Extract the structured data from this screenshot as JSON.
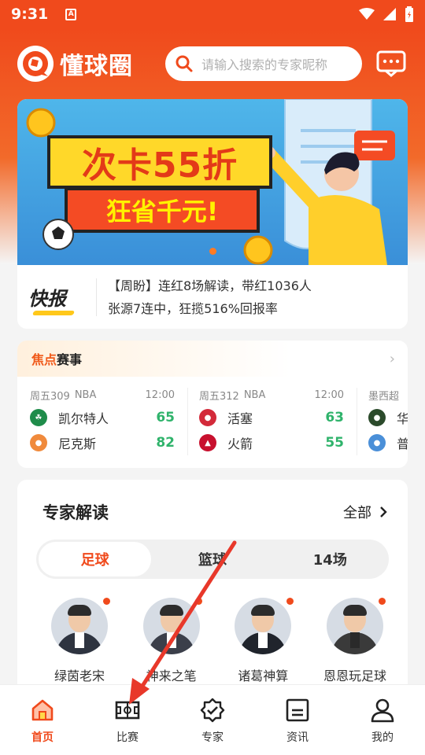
{
  "status": {
    "time": "9:31",
    "a_badge": "A"
  },
  "header": {
    "app_name": "懂球圈",
    "search_placeholder": "请输入搜索的专家昵称"
  },
  "banner": {
    "title": "次卡55折",
    "subtitle": "狂省千元!"
  },
  "news": {
    "badge": "快报",
    "line1": "【周盼】连红8场解读，带红1036人",
    "line2": "张源7连中，狂揽516%回报率"
  },
  "focus": {
    "title_hl": "焦点",
    "title_rest": "赛事",
    "matches": [
      {
        "code": "周五309",
        "league": "NBA",
        "time": "12:00",
        "home": "凯尔特人",
        "home_score": "65",
        "away": "尼克斯",
        "away_score": "82"
      },
      {
        "code": "周五312",
        "league": "NBA",
        "time": "12:00",
        "home": "活塞",
        "home_score": "63",
        "away": "火箭",
        "away_score": "55"
      },
      {
        "code": "墨西超",
        "league": "",
        "time": "",
        "home": "华",
        "home_score": "",
        "away": "普",
        "away_score": ""
      }
    ]
  },
  "expert": {
    "title": "专家解读",
    "all_label": "全部",
    "tabs": [
      "足球",
      "篮球",
      "14场"
    ],
    "experts": [
      {
        "name": "绿茵老宋"
      },
      {
        "name": "神来之笔"
      },
      {
        "name": "诸葛神算"
      },
      {
        "name": "恩恩玩足球"
      }
    ]
  },
  "nav": {
    "items": [
      {
        "label": "首页",
        "icon": "home-icon"
      },
      {
        "label": "比赛",
        "icon": "match-icon"
      },
      {
        "label": "专家",
        "icon": "expert-icon"
      },
      {
        "label": "资讯",
        "icon": "news-icon"
      },
      {
        "label": "我的",
        "icon": "profile-icon"
      }
    ],
    "active": "首页"
  },
  "colors": {
    "brand": "#f04a1c",
    "score": "#2fb36b",
    "annotation_arrow": "#e8382a"
  }
}
